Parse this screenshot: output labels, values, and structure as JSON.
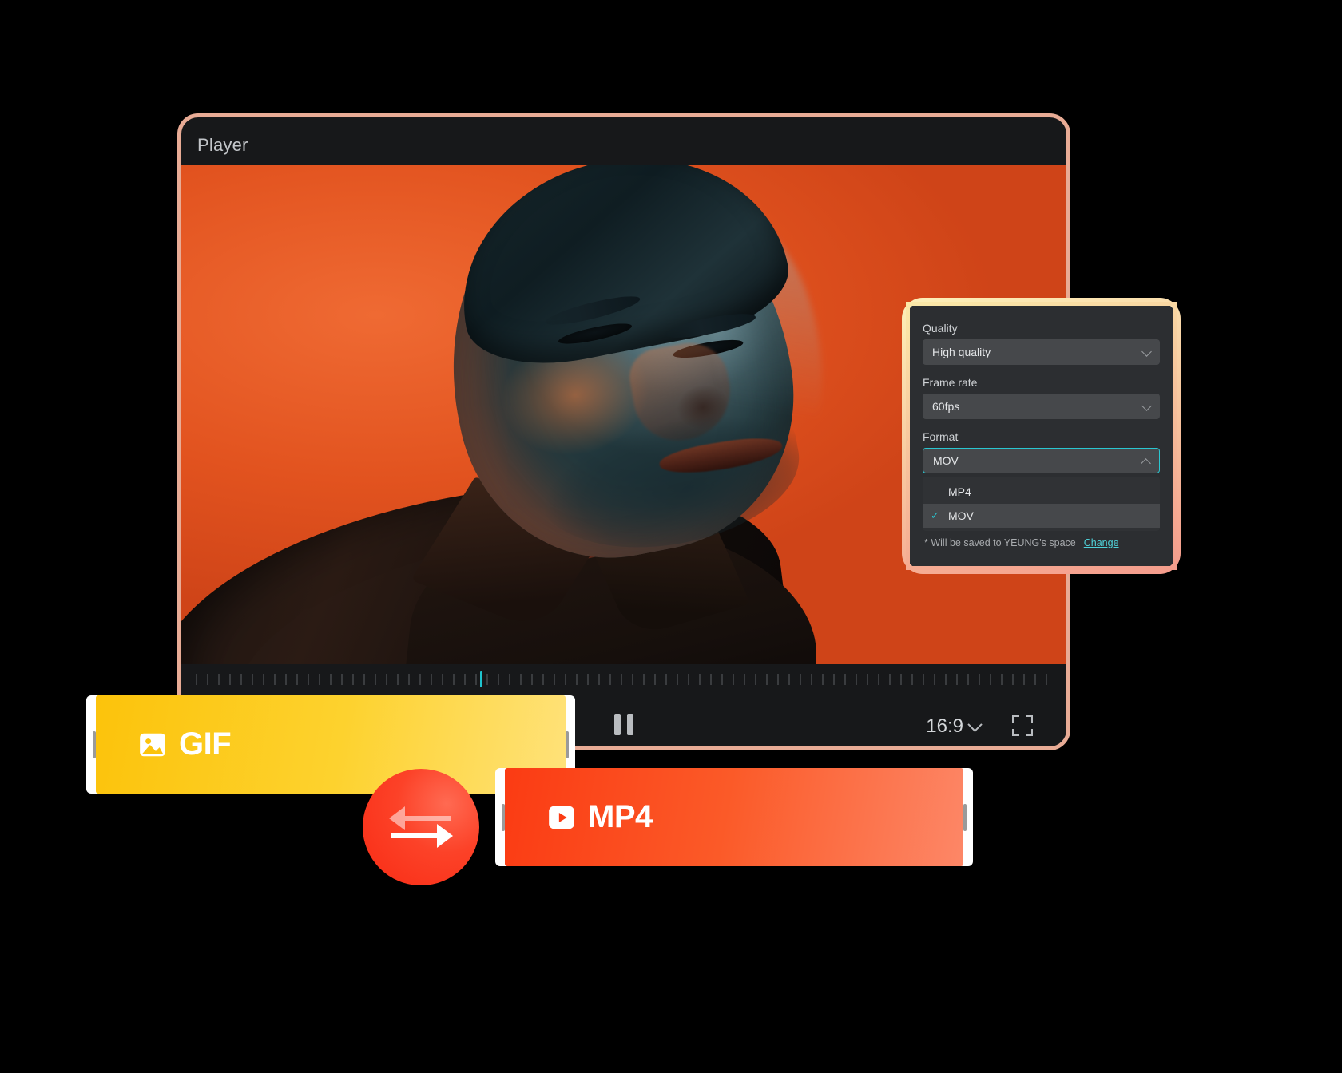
{
  "player": {
    "title": "Player",
    "aspect_ratio": "16:9",
    "pause_icon": "pause-icon",
    "fullscreen_icon": "fullscreen-icon",
    "aspect_chevron_icon": "chevron-down-icon",
    "playhead_position_pct": 34
  },
  "export_panel": {
    "quality": {
      "label": "Quality",
      "value": "High quality",
      "chevron_icon": "chevron-down-icon"
    },
    "frame_rate": {
      "label": "Frame rate",
      "value": "60fps",
      "chevron_icon": "chevron-down-icon"
    },
    "format": {
      "label": "Format",
      "value": "MOV",
      "chevron_icon": "chevron-up-icon",
      "expanded": true,
      "options": [
        {
          "label": "MP4",
          "selected": false
        },
        {
          "label": "MOV",
          "selected": true
        }
      ],
      "check_icon": "check-icon"
    },
    "save_note": "* Will be saved to YEUNG's space",
    "change_link": "Change"
  },
  "badges": {
    "gif": {
      "label": "GIF",
      "icon": "image-icon",
      "color_start": "#fcc30b",
      "color_end": "#ffe27a"
    },
    "mp4": {
      "label": "MP4",
      "icon": "play-video-icon",
      "color_start": "#fb3b13",
      "color_end": "#fd8767"
    },
    "swap": {
      "icon": "swap-arrows-icon",
      "color": "#f92b14"
    }
  },
  "theme": {
    "accent_teal": "#2ac6d0",
    "panel_bg": "#2c2e31",
    "window_bg": "#17181a",
    "frame_border": "#e8ab95"
  }
}
